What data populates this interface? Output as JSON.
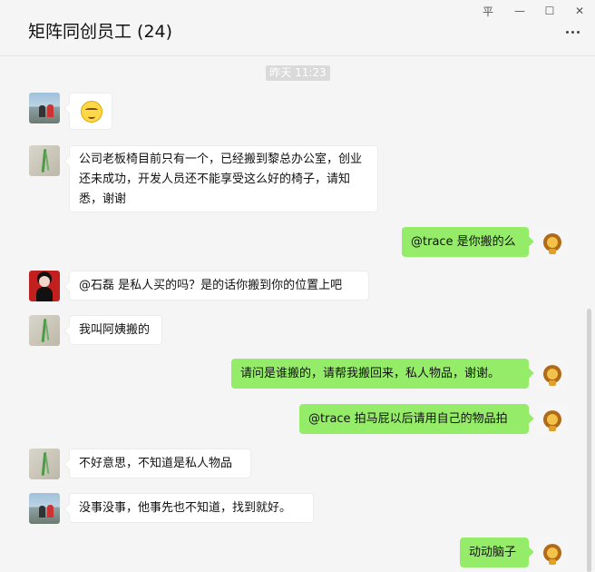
{
  "window": {
    "title": "矩阵同创员工 (24)",
    "controls": {
      "pin": "平",
      "minimize": "—",
      "maximize": "☐",
      "close": "✕"
    }
  },
  "chat": {
    "timestamp": "昨天 11:23",
    "messages": [
      {
        "side": "left",
        "avatar": "lake-photo-avatar",
        "type": "emoji",
        "emoji": "sweat-emoji"
      },
      {
        "side": "left",
        "avatar": "bamboo-avatar",
        "text": "公司老板椅目前只有一个，已经搬到黎总办公室，创业还未成功，开发人员还不能享受这么好的椅子，请知悉，谢谢"
      },
      {
        "side": "right",
        "avatar": "lion-avatar",
        "text": "@trace 是你搬的么"
      },
      {
        "side": "left",
        "avatar": "red-portrait-avatar",
        "text": "@石磊 是私人买的吗？是的话你搬到你的位置上吧"
      },
      {
        "side": "left",
        "avatar": "bamboo-avatar",
        "text": "我叫阿姨搬的"
      },
      {
        "side": "right",
        "avatar": "lion-avatar",
        "text": "请问是谁搬的，请帮我搬回来，私人物品，谢谢。"
      },
      {
        "side": "right",
        "avatar": "lion-avatar",
        "text": "@trace 拍马屁以后请用自己的物品拍"
      },
      {
        "side": "left",
        "avatar": "bamboo-avatar",
        "text": "不好意思，不知道是私人物品"
      },
      {
        "side": "left",
        "avatar": "lake-photo-avatar",
        "text": "没事没事，他事先也不知道，找到就好。"
      },
      {
        "side": "right",
        "avatar": "lion-avatar",
        "text": "动动脑子"
      }
    ]
  }
}
